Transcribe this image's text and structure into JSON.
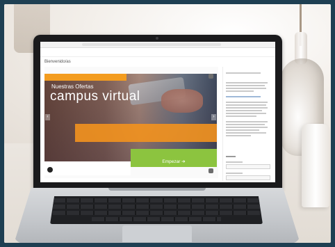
{
  "screen": {
    "welcome_title": "Bienvenido/as",
    "banner": {
      "subtitle": "Nuestras Ofertas",
      "title": "campus virtual",
      "start_button": "Empezar ➔"
    }
  },
  "colors": {
    "frame": "#1e3f52",
    "banner_orange": "#f39c1f",
    "button_green": "#8cc43f"
  }
}
